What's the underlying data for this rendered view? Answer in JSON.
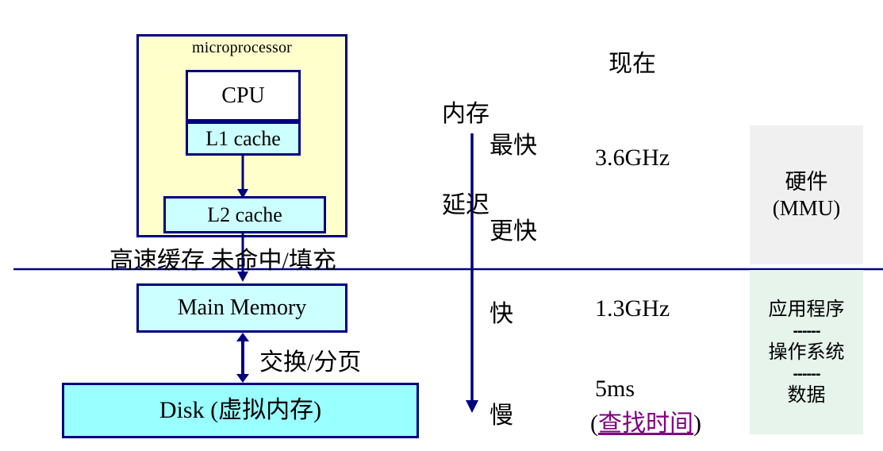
{
  "diagram": {
    "title_label": "microprocessor",
    "boxes": {
      "cpu": "CPU",
      "l1_cache": "L1 cache",
      "l2_cache": "L2 cache",
      "main_memory": "Main Memory",
      "disk": "Disk (虚拟内存)"
    },
    "edge_labels": {
      "cache_miss_fill": "高速缓存 未命中/填充",
      "swap_paging": "交换/分页"
    },
    "colors": {
      "microprocessor_fill": "#ffffcc",
      "cache_fill": "#ccffff",
      "disk_fill": "#99ffff",
      "border": "#000080",
      "divider": "#000080",
      "hardware_panel_fill": "#f0f0f0",
      "software_panel_fill": "#e6f4ec",
      "link_text": "#800080"
    }
  },
  "latency_column": {
    "header_line1": "内存",
    "header_line2": "延迟",
    "levels": [
      {
        "key": "fastest",
        "label": "最快"
      },
      {
        "key": "faster",
        "label": "更快"
      },
      {
        "key": "fast",
        "label": "快"
      },
      {
        "key": "slow",
        "label": "慢"
      }
    ]
  },
  "now_column": {
    "header": "现在",
    "values": [
      {
        "key": "cpu",
        "label": "3.6GHz"
      },
      {
        "key": "mem",
        "label": "1.3GHz"
      },
      {
        "key": "disk",
        "label": "5ms"
      }
    ],
    "seek_time": {
      "open_paren": "(",
      "link_label": "查找时间",
      "close_paren": ")"
    }
  },
  "side_panels": {
    "hardware": {
      "line1": "硬件",
      "line2": "(MMU)"
    },
    "software": {
      "line1": "应用程序",
      "separator1": "------",
      "line2": "操作系统",
      "separator2": "------",
      "line3": "数据"
    }
  }
}
